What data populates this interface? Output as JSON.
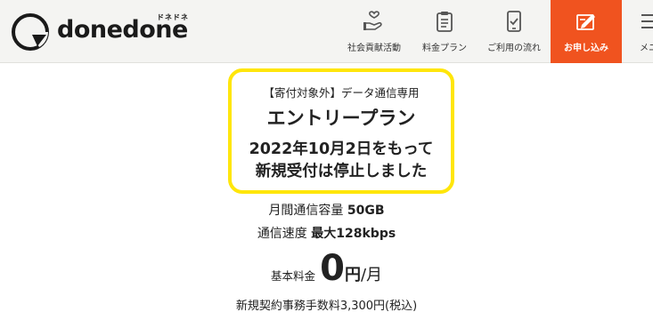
{
  "header": {
    "logo_text": "donedone",
    "logo_kana": "ドネドネ",
    "nav": [
      {
        "label": "社会貢献活動",
        "icon": "hand-heart-icon"
      },
      {
        "label": "料金プラン",
        "icon": "clipboard-icon"
      },
      {
        "label": "ご利用の流れ",
        "icon": "phone-check-icon"
      },
      {
        "label": "お申し込み",
        "icon": "apply-form-icon",
        "active": true
      },
      {
        "label": "メニュー",
        "icon": "menu-icon",
        "visible_text": "メニ"
      }
    ],
    "colors": {
      "background": "#f4f4f2",
      "accent": "#f0531f"
    }
  },
  "notice": {
    "subtitle": "【寄付対象外】データ通信専用",
    "title": "エントリープラン",
    "message_line1": "2022年10月2日をもって",
    "message_line2": "新規受付は停止しました",
    "border_color": "#ffe60a"
  },
  "specs": {
    "capacity_label": "月間通信容量",
    "capacity_value": "50GB",
    "speed_label": "通信速度",
    "speed_value": "最大128kbps"
  },
  "price": {
    "label": "基本料金",
    "value": "0",
    "unit": "円",
    "period": "/月"
  },
  "fee": {
    "text": "新規契約事務手数料3,300円(税込)"
  }
}
